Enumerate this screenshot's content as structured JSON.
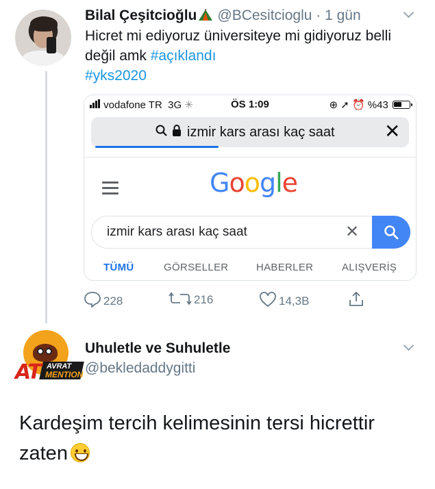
{
  "tweet1": {
    "display_name": "Bilal Çeşitcioğlu",
    "name_emoji": "tent-icon",
    "handle": "@BCesitcioglu",
    "separator": "·",
    "time": "1 gün",
    "text_before": "Hicret mi ediyoruz üniversiteye mi gidiyoruz belli değil amk ",
    "hashtag1": "#açıklandı",
    "hashtag2": "#yks2020",
    "screenshot": {
      "carrier": "vodafone TR",
      "network": "3G",
      "clock": "ÖS 1:09",
      "battery": "%43",
      "url_text": "izmir kars arası kaç saat",
      "search_query": "izmir kars arası kaç saat",
      "logo": [
        "G",
        "o",
        "o",
        "g",
        "l",
        "e"
      ],
      "logo_colors": [
        "#4285f4",
        "#ea4335",
        "#fbbc05",
        "#4285f4",
        "#34a853",
        "#ea4335"
      ],
      "tabs": [
        "TÜMÜ",
        "GÖRSELLER",
        "HABERLER",
        "ALIŞVERİŞ"
      ],
      "active_tab": "TÜMÜ"
    },
    "actions": {
      "replies": "228",
      "retweets": "216",
      "likes": "14,3B"
    }
  },
  "tweet2": {
    "display_name": "Uhuletle ve Suhuletle",
    "handle": "@bekledaddygitti",
    "avatar_text": {
      "big": "AT",
      "line1": "AVRAT",
      "line2": "MENTION"
    },
    "text": "Kardeşim tercih kelimesinin tersi hicrettir zaten",
    "emoji": "grinning-face-icon"
  },
  "colors": {
    "link": "#1b95e0",
    "muted": "#657786",
    "google_blue": "#4285f4"
  }
}
